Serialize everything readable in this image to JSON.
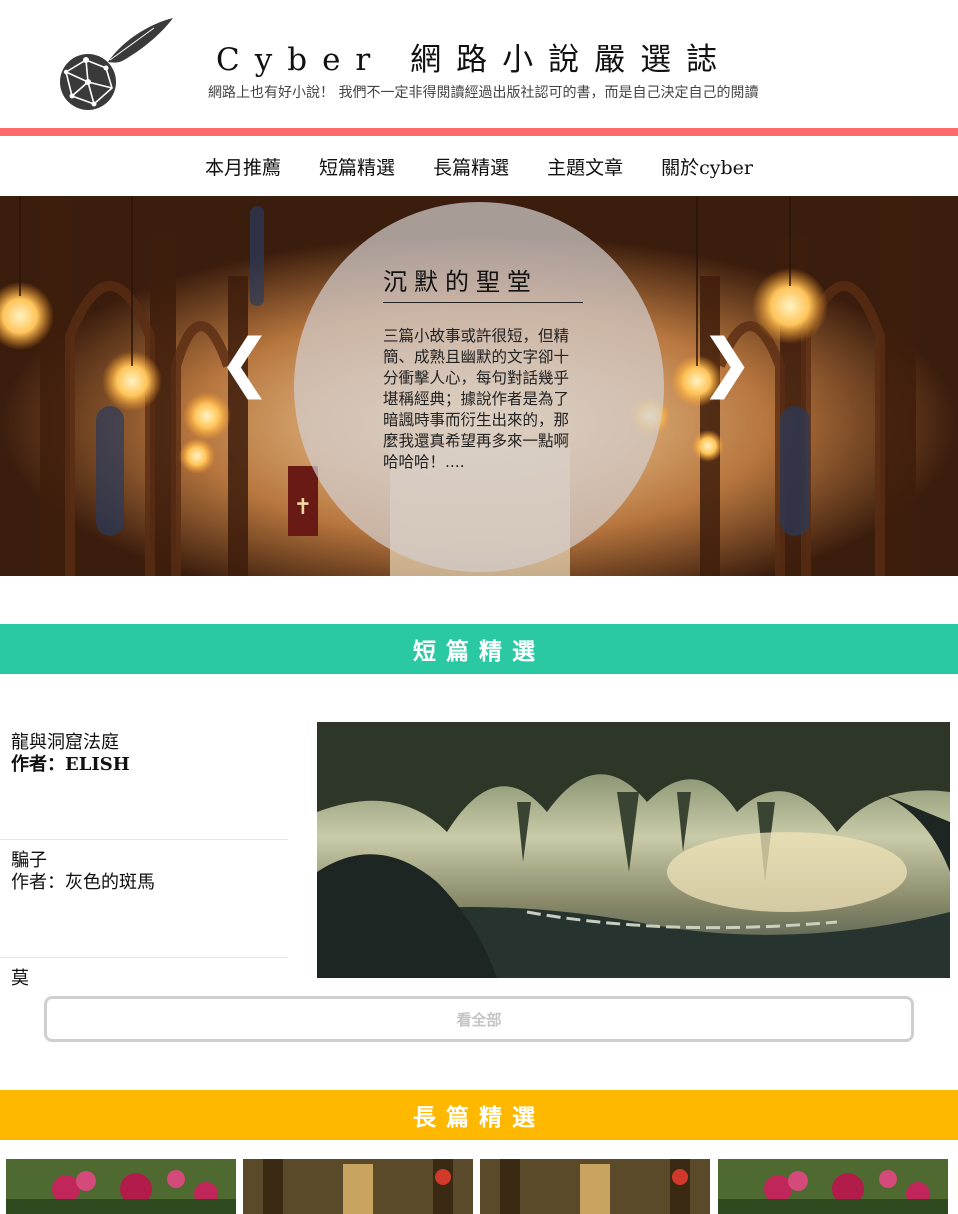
{
  "header": {
    "title": "Cyber 網路小說嚴選誌",
    "tagline": "網路上也有好小說！ 我們不一定非得閱讀經過出版社認可的書，而是自己決定自己的閱讀"
  },
  "nav": {
    "items": [
      "本月推薦",
      "短篇精選",
      "長篇精選",
      "主題文章",
      "關於cyber"
    ]
  },
  "hero": {
    "title": "沉默的聖堂",
    "text": "三篇小故事或許很短，但精簡、成熟且幽默的文字卻十分衝擊人心，每句對話幾乎堪稱經典；據說作者是為了暗諷時事而衍生出來的，那麼我還真希望再多來一點啊哈哈哈！....",
    "prev": "❮",
    "next": "❯"
  },
  "short_section": {
    "heading": "短篇精選",
    "stories": [
      {
        "title": "龍與洞窟法庭",
        "author": "作者：ELISH"
      },
      {
        "title": "騙子",
        "author": "作者：灰色的斑馬"
      },
      {
        "title": "莫",
        "author": ""
      }
    ],
    "see_all": "看全部"
  },
  "long_section": {
    "heading": "長篇精選"
  },
  "colors": {
    "accent_red": "#ff6a6a",
    "short_band": "#2bc9a3",
    "long_band": "#ffb800"
  }
}
